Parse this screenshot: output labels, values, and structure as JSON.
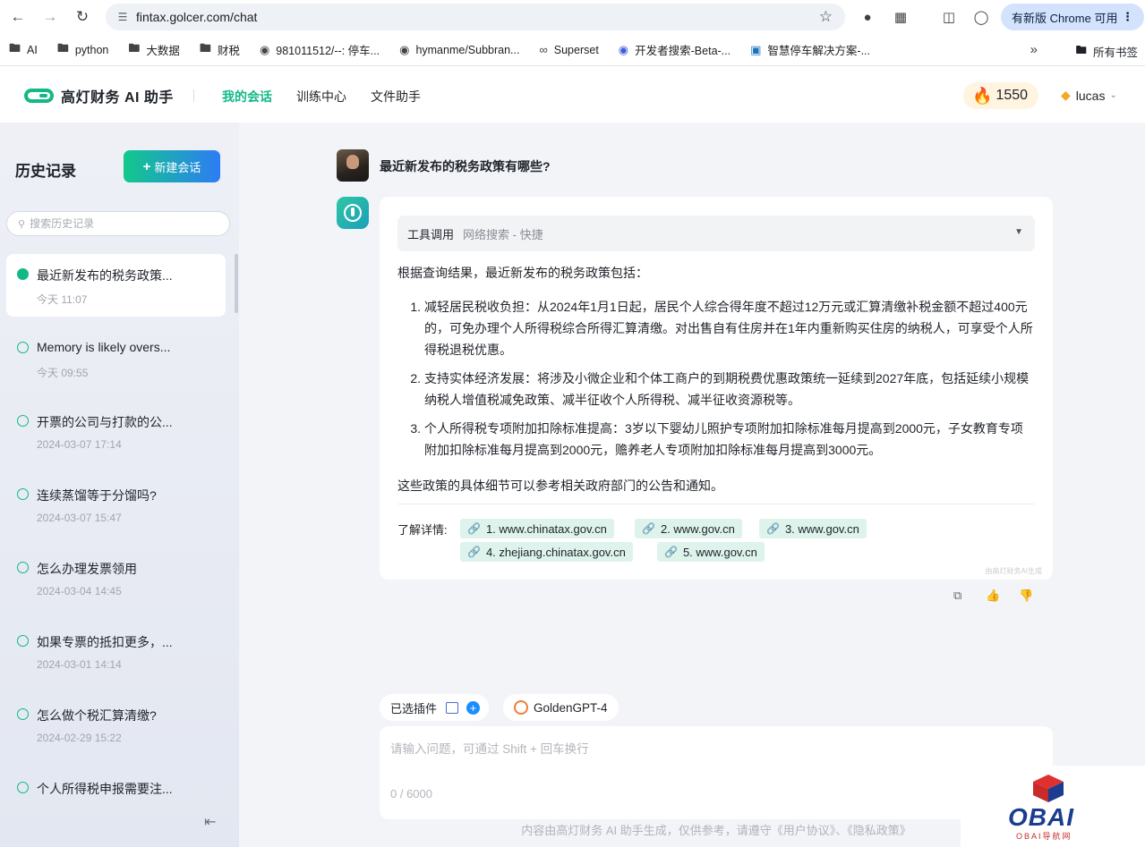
{
  "browser": {
    "url": "fintax.golcer.com/chat",
    "update_label": "有新版 Chrome 可用",
    "bookmarks": [
      "AI",
      "python",
      "大数据",
      "财税",
      "981011512/--: 停车...",
      "hymanme/Subbran...",
      "Superset",
      "开发者搜索-Beta-...",
      "智慧停车解决方案-..."
    ],
    "all_bookmarks": "所有书签"
  },
  "header": {
    "logo_text": "高灯财务 AI 助手",
    "nav": [
      "我的会话",
      "训练中心",
      "文件助手"
    ],
    "points": "1550",
    "username": "lucas"
  },
  "sidebar": {
    "title": "历史记录",
    "new_chat": "新建会话",
    "search_placeholder": "搜索历史记录",
    "items": [
      {
        "title": "最近新发布的税务政策...",
        "time": "今天 11:07"
      },
      {
        "title": "Memory is likely overs...",
        "time": "今天 09:55"
      },
      {
        "title": "开票的公司与打款的公...",
        "time": "2024-03-07 17:14"
      },
      {
        "title": "连续蒸馏等于分馏吗?",
        "time": "2024-03-07 15:47"
      },
      {
        "title": "怎么办理发票领用",
        "time": "2024-03-04 14:45"
      },
      {
        "title": "如果专票的抵扣更多，...",
        "time": "2024-03-01 14:14"
      },
      {
        "title": "怎么做个税汇算清缴?",
        "time": "2024-02-29 15:22"
      },
      {
        "title": "个人所得税申报需要注...",
        "time": ""
      }
    ]
  },
  "chat": {
    "question": "最近新发布的税务政策有哪些?",
    "tool_label": "工具调用",
    "tool_value": "网络搜索 - 快捷",
    "intro": "根据查询结果，最近新发布的税务政策包括：",
    "policies": [
      {
        "num": "1.",
        "text": "减轻居民税收负担：从2024年1月1日起，居民个人综合得年度不超过12万元或汇算清缴补税金额不超过400元的，可免办理个人所得税综合所得汇算清缴。对出售自有住房并在1年内重新购买住房的纳税人，可享受个人所得税退税优惠。"
      },
      {
        "num": "2.",
        "text": "支持实体经济发展：将涉及小微企业和个体工商户的到期税费优惠政策统一延续到2027年底，包括延续小规模纳税人增值税减免政策、减半征收个人所得税、减半征收资源税等。"
      },
      {
        "num": "3.",
        "text": "个人所得税专项附加扣除标准提高：3岁以下婴幼儿照护专项附加扣除标准每月提高到2000元，子女教育专项附加扣除标准每月提高到2000元，赡养老人专项附加扣除标准每月提高到3000元。"
      }
    ],
    "outro": "这些政策的具体细节可以参考相关政府部门的公告和通知。",
    "refs_label": "了解详情:",
    "refs": [
      "1. www.chinatax.gov.cn",
      "2. www.gov.cn",
      "3. www.gov.cn",
      "4. zhejiang.chinatax.gov.cn",
      "5. www.gov.cn"
    ],
    "card_watermark": "由高灯财务AI生成"
  },
  "composer": {
    "plugin_label": "已选插件",
    "model": "GoldenGPT-4",
    "placeholder": "请输入问题，可通过 Shift + 回车换行",
    "counter": "0 / 6000",
    "disclaimer": "内容由高灯财务 AI 助手生成，仅供参考，请遵守《用户协议》、《隐私政策》"
  },
  "watermark": {
    "text": "OBAI",
    "sub": "OBAI导航网"
  }
}
